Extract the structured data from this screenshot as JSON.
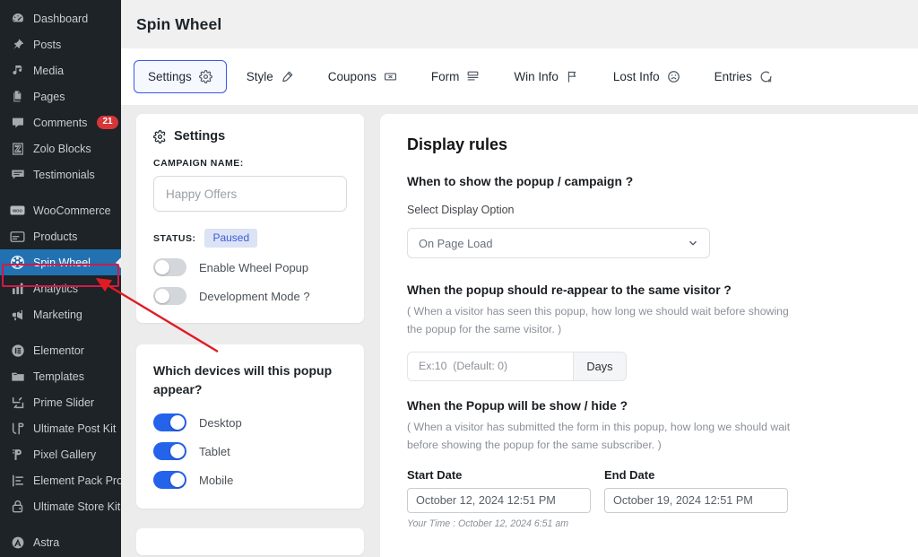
{
  "sidebar": {
    "items": [
      {
        "label": "Dashboard",
        "icon": "dashboard-icon",
        "active": false
      },
      {
        "label": "Posts",
        "icon": "pin-icon",
        "active": false
      },
      {
        "label": "Media",
        "icon": "media-icon",
        "active": false
      },
      {
        "label": "Pages",
        "icon": "pages-icon",
        "active": false
      },
      {
        "label": "Comments",
        "icon": "comment-icon",
        "active": false,
        "badge": "21"
      },
      {
        "label": "Zolo Blocks",
        "icon": "zolo-blocks-icon",
        "active": false
      },
      {
        "label": "Testimonials",
        "icon": "testimonials-icon",
        "active": false
      },
      {
        "label": "WooCommerce",
        "icon": "woocommerce-icon",
        "active": false,
        "gap_before": true
      },
      {
        "label": "Products",
        "icon": "products-icon",
        "active": false
      },
      {
        "label": "Spin Wheel",
        "icon": "spin-wheel-icon",
        "active": true
      },
      {
        "label": "Analytics",
        "icon": "analytics-icon",
        "active": false
      },
      {
        "label": "Marketing",
        "icon": "marketing-icon",
        "active": false
      },
      {
        "label": "Elementor",
        "icon": "elementor-icon",
        "active": false,
        "gap_before": true
      },
      {
        "label": "Templates",
        "icon": "templates-icon",
        "active": false
      },
      {
        "label": "Prime Slider",
        "icon": "prime-slider-icon",
        "active": false
      },
      {
        "label": "Ultimate Post Kit",
        "icon": "ultimate-post-kit-icon",
        "active": false
      },
      {
        "label": "Pixel Gallery",
        "icon": "pixel-gallery-icon",
        "active": false
      },
      {
        "label": "Element Pack Pro",
        "icon": "element-pack-pro-icon",
        "active": false
      },
      {
        "label": "Ultimate Store Kit",
        "icon": "ultimate-store-kit-icon",
        "active": false
      },
      {
        "label": "Astra",
        "icon": "astra-icon",
        "active": false,
        "gap_before": true
      }
    ]
  },
  "header": {
    "title": "Spin Wheel"
  },
  "tabs": [
    {
      "label": "Settings",
      "icon": "gear-icon",
      "active": true
    },
    {
      "label": "Style",
      "icon": "brush-icon",
      "active": false
    },
    {
      "label": "Coupons",
      "icon": "ticket-icon",
      "active": false
    },
    {
      "label": "Form",
      "icon": "form-icon",
      "active": false
    },
    {
      "label": "Win Info",
      "icon": "flag-icon",
      "active": false
    },
    {
      "label": "Lost Info",
      "icon": "sad-face-icon",
      "active": false
    },
    {
      "label": "Entries",
      "icon": "entries-icon",
      "active": false
    }
  ],
  "settings_card": {
    "title": "Settings",
    "campaign_name_label": "CAMPAIGN NAME:",
    "campaign_name_placeholder": "Happy Offers",
    "campaign_name_value": "",
    "status_label": "STATUS:",
    "status_value": "Paused",
    "toggles": [
      {
        "label": "Enable Wheel Popup",
        "on": false
      },
      {
        "label": "Development Mode ?",
        "on": false
      }
    ]
  },
  "devices_card": {
    "question": "Which devices will this popup appear?",
    "toggles": [
      {
        "label": "Desktop",
        "on": true
      },
      {
        "label": "Tablet",
        "on": true
      },
      {
        "label": "Mobile",
        "on": true
      }
    ]
  },
  "display_rules": {
    "heading": "Display rules",
    "when_show_question": "When to show the popup / campaign ?",
    "select_display_label": "Select Display Option",
    "select_display_value": "On Page Load",
    "reappear_question": "When the popup should re-appear to the same visitor ?",
    "reappear_hint": "( When a visitor has seen this popup, how long we should wait before showing the popup for the same visitor. )",
    "days_placeholder": "Ex:10  (Default: 0)",
    "days_value": "",
    "days_unit": "Days",
    "show_hide_question": "When the Popup will be show / hide ?",
    "show_hide_hint": "( When a visitor has submitted the form in this popup, how long we should wait before showing the popup for the same subscriber. )",
    "start_date_label": "Start Date",
    "start_date_value": "October 12, 2024 12:51 PM",
    "end_date_label": "End Date",
    "end_date_value": "October 19, 2024 12:51 PM",
    "your_time": "Your Time : October 12, 2024 6:51 am"
  },
  "colors": {
    "sidebar_bg": "#1d2327",
    "active_item": "#2271b1",
    "accent_blue": "#3858e9",
    "toggle_on": "#2563eb",
    "badge_red": "#d63638",
    "highlight_red": "#d11a4a",
    "status_pill_bg": "#dbe3f5",
    "status_pill_text": "#3b5bdb"
  }
}
